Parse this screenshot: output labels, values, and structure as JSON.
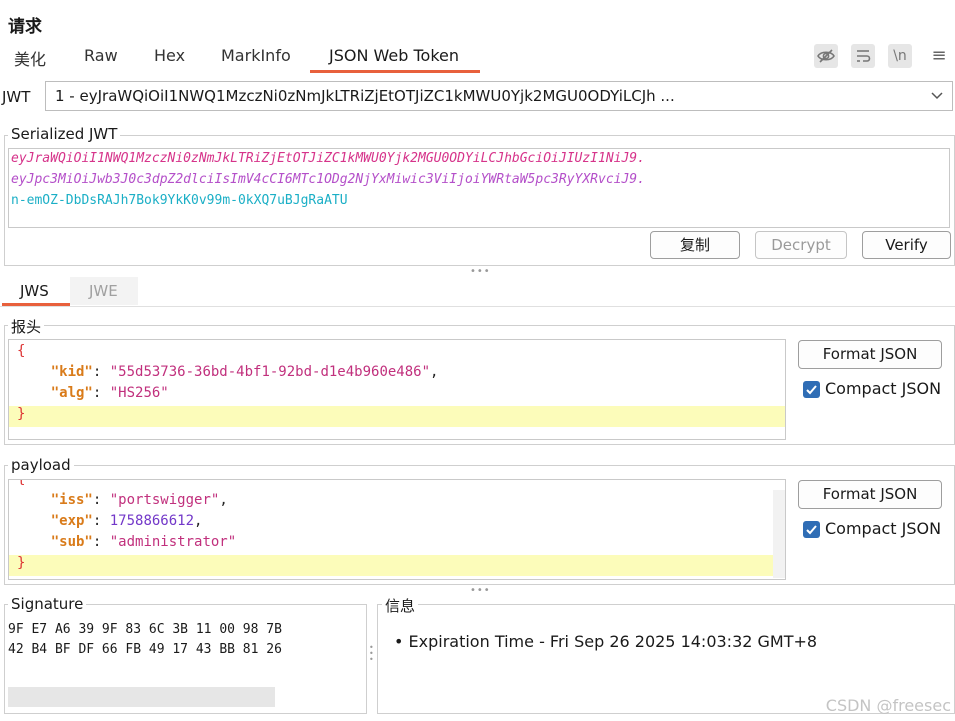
{
  "header": {
    "title": "请求"
  },
  "tabs": [
    {
      "label": "美化"
    },
    {
      "label": "Raw"
    },
    {
      "label": "Hex"
    },
    {
      "label": "MarkInfo"
    },
    {
      "label": "JSON Web Token"
    }
  ],
  "toolbar": {
    "wrap_label": "\\n"
  },
  "jwt_selector": {
    "label": "JWT",
    "selected": "1 - eyJraWQiOiI1NWQ1MzczNi0zNmJkLTRiZjEtOTJiZC1kMWU0Yjk2MGU0ODYiLCJh ..."
  },
  "serialized": {
    "title": "Serialized JWT",
    "header_part": "eyJraWQiOiI1NWQ1MzczNi0zNmJkLTRiZjEtOTJiZC1kMWU0Yjk2MGU0ODYiLCJhbGciOiJIUzI1NiJ9.",
    "payload_part": "eyJpc3MiOiJwb3J0c3dpZ2dlciIsImV4cCI6MTc1ODg2NjYxMiwic3ViIjoiYWRtaW5pc3RyYXRvciJ9.",
    "signature_part": "n-emOZ-DbDsRAJh7Bok9YkK0v99m-0kXQ7uBJgRaATU",
    "copy_label": "复制",
    "decrypt_label": "Decrypt",
    "verify_label": "Verify"
  },
  "sub_tabs": [
    {
      "label": "JWS"
    },
    {
      "label": "JWE"
    }
  ],
  "header_section": {
    "title": "报头",
    "open_brace": "{",
    "close_brace": "}",
    "fields": [
      {
        "key": "\"kid\"",
        "value": "\"55d53736-36bd-4bf1-92bd-d1e4b960e486\"",
        "suffix": ","
      },
      {
        "key": "\"alg\"",
        "value": "\"HS256\"",
        "suffix": ""
      }
    ],
    "format_label": "Format JSON",
    "compact_label": "Compact JSON",
    "compact_checked": true
  },
  "payload_section": {
    "title": "payload",
    "open_brace": "{",
    "close_brace": "}",
    "fields": [
      {
        "key": "\"iss\"",
        "value": "\"portswigger\"",
        "suffix": ",",
        "type": "str"
      },
      {
        "key": "\"exp\"",
        "value": "1758866612",
        "suffix": ",",
        "type": "num"
      },
      {
        "key": "\"sub\"",
        "value": "\"administrator\"",
        "suffix": "",
        "type": "str"
      }
    ],
    "format_label": "Format JSON",
    "compact_label": "Compact JSON",
    "compact_checked": true
  },
  "signature": {
    "title": "Signature",
    "line1": "9F E7 A6 39 9F 83 6C 3B 11 00 98 7B",
    "line2": "42 B4 BF DF 66 FB 49 17 43 BB 81 26"
  },
  "info": {
    "title": "信息",
    "items": [
      "• Expiration Time - Fri Sep 26 2025 14:03:32 GMT+8"
    ]
  },
  "watermark": "CSDN @freesec",
  "colors": {
    "accent": "#e8603c",
    "jwt_header": "#d6338a",
    "jwt_payload": "#b44fc9",
    "jwt_signature": "#1bafc6",
    "checkbox": "#2f6db5"
  }
}
